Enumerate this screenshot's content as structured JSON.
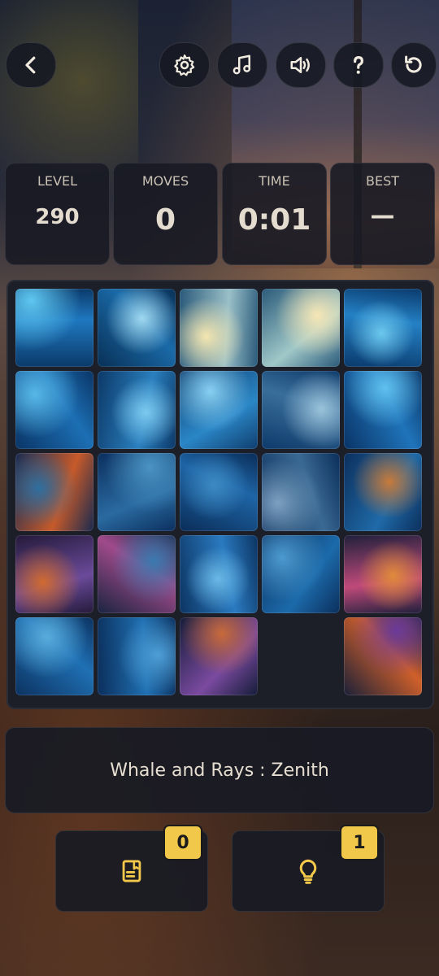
{
  "toolbar": {
    "back_icon": "chevron-left-icon",
    "settings_icon": "gear-icon",
    "music_icon": "music-note-icon",
    "sound_icon": "speaker-icon",
    "help_icon": "question-icon",
    "restart_icon": "restart-icon"
  },
  "stats": {
    "level_label": "LEVEL",
    "level_value": "290",
    "moves_label": "MOVES",
    "moves_value": "0",
    "time_label": "TIME",
    "time_value": "0:01",
    "best_label": "BEST",
    "best_value": "—"
  },
  "board": {
    "rows": 5,
    "cols": 5,
    "empty_slot": 23
  },
  "puzzle_title": "Whale and Rays : Zenith",
  "actions": {
    "notes_badge": "0",
    "hint_badge": "1"
  },
  "colors": {
    "accent": "#f2c84b",
    "panel": "#181a24",
    "text": "#e6ded0"
  }
}
